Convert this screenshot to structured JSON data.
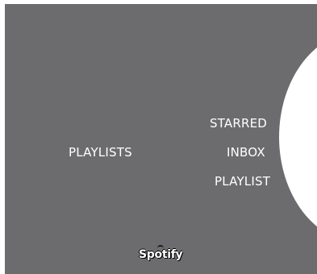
{
  "menu": {
    "left_label": "PLAYLISTS",
    "wheel_items": [
      {
        "label": "STARRED"
      },
      {
        "label": "INBOX"
      },
      {
        "label": "PLAYLIST"
      }
    ]
  },
  "brand": {
    "logo_text": "Spotify"
  },
  "colors": {
    "panel_background": "#6c6c6f",
    "wheel_background": "#ffffff",
    "label_text": "#ffffff"
  }
}
